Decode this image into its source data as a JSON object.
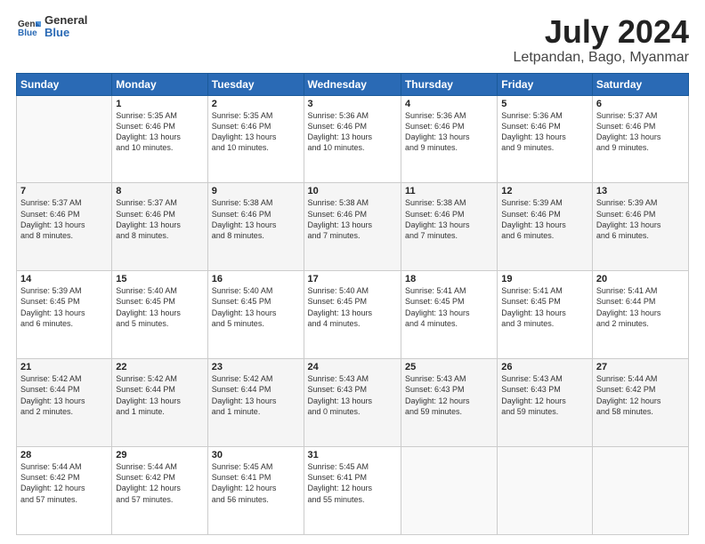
{
  "logo": {
    "line1": "General",
    "line2": "Blue"
  },
  "title": "July 2024",
  "subtitle": "Letpandan, Bago, Myanmar",
  "days_header": [
    "Sunday",
    "Monday",
    "Tuesday",
    "Wednesday",
    "Thursday",
    "Friday",
    "Saturday"
  ],
  "weeks": [
    [
      {
        "num": "",
        "info": ""
      },
      {
        "num": "1",
        "info": "Sunrise: 5:35 AM\nSunset: 6:46 PM\nDaylight: 13 hours\nand 10 minutes."
      },
      {
        "num": "2",
        "info": "Sunrise: 5:35 AM\nSunset: 6:46 PM\nDaylight: 13 hours\nand 10 minutes."
      },
      {
        "num": "3",
        "info": "Sunrise: 5:36 AM\nSunset: 6:46 PM\nDaylight: 13 hours\nand 10 minutes."
      },
      {
        "num": "4",
        "info": "Sunrise: 5:36 AM\nSunset: 6:46 PM\nDaylight: 13 hours\nand 9 minutes."
      },
      {
        "num": "5",
        "info": "Sunrise: 5:36 AM\nSunset: 6:46 PM\nDaylight: 13 hours\nand 9 minutes."
      },
      {
        "num": "6",
        "info": "Sunrise: 5:37 AM\nSunset: 6:46 PM\nDaylight: 13 hours\nand 9 minutes."
      }
    ],
    [
      {
        "num": "7",
        "info": "Sunrise: 5:37 AM\nSunset: 6:46 PM\nDaylight: 13 hours\nand 8 minutes."
      },
      {
        "num": "8",
        "info": "Sunrise: 5:37 AM\nSunset: 6:46 PM\nDaylight: 13 hours\nand 8 minutes."
      },
      {
        "num": "9",
        "info": "Sunrise: 5:38 AM\nSunset: 6:46 PM\nDaylight: 13 hours\nand 8 minutes."
      },
      {
        "num": "10",
        "info": "Sunrise: 5:38 AM\nSunset: 6:46 PM\nDaylight: 13 hours\nand 7 minutes."
      },
      {
        "num": "11",
        "info": "Sunrise: 5:38 AM\nSunset: 6:46 PM\nDaylight: 13 hours\nand 7 minutes."
      },
      {
        "num": "12",
        "info": "Sunrise: 5:39 AM\nSunset: 6:46 PM\nDaylight: 13 hours\nand 6 minutes."
      },
      {
        "num": "13",
        "info": "Sunrise: 5:39 AM\nSunset: 6:46 PM\nDaylight: 13 hours\nand 6 minutes."
      }
    ],
    [
      {
        "num": "14",
        "info": "Sunrise: 5:39 AM\nSunset: 6:45 PM\nDaylight: 13 hours\nand 6 minutes."
      },
      {
        "num": "15",
        "info": "Sunrise: 5:40 AM\nSunset: 6:45 PM\nDaylight: 13 hours\nand 5 minutes."
      },
      {
        "num": "16",
        "info": "Sunrise: 5:40 AM\nSunset: 6:45 PM\nDaylight: 13 hours\nand 5 minutes."
      },
      {
        "num": "17",
        "info": "Sunrise: 5:40 AM\nSunset: 6:45 PM\nDaylight: 13 hours\nand 4 minutes."
      },
      {
        "num": "18",
        "info": "Sunrise: 5:41 AM\nSunset: 6:45 PM\nDaylight: 13 hours\nand 4 minutes."
      },
      {
        "num": "19",
        "info": "Sunrise: 5:41 AM\nSunset: 6:45 PM\nDaylight: 13 hours\nand 3 minutes."
      },
      {
        "num": "20",
        "info": "Sunrise: 5:41 AM\nSunset: 6:44 PM\nDaylight: 13 hours\nand 2 minutes."
      }
    ],
    [
      {
        "num": "21",
        "info": "Sunrise: 5:42 AM\nSunset: 6:44 PM\nDaylight: 13 hours\nand 2 minutes."
      },
      {
        "num": "22",
        "info": "Sunrise: 5:42 AM\nSunset: 6:44 PM\nDaylight: 13 hours\nand 1 minute."
      },
      {
        "num": "23",
        "info": "Sunrise: 5:42 AM\nSunset: 6:44 PM\nDaylight: 13 hours\nand 1 minute."
      },
      {
        "num": "24",
        "info": "Sunrise: 5:43 AM\nSunset: 6:43 PM\nDaylight: 13 hours\nand 0 minutes."
      },
      {
        "num": "25",
        "info": "Sunrise: 5:43 AM\nSunset: 6:43 PM\nDaylight: 12 hours\nand 59 minutes."
      },
      {
        "num": "26",
        "info": "Sunrise: 5:43 AM\nSunset: 6:43 PM\nDaylight: 12 hours\nand 59 minutes."
      },
      {
        "num": "27",
        "info": "Sunrise: 5:44 AM\nSunset: 6:42 PM\nDaylight: 12 hours\nand 58 minutes."
      }
    ],
    [
      {
        "num": "28",
        "info": "Sunrise: 5:44 AM\nSunset: 6:42 PM\nDaylight: 12 hours\nand 57 minutes."
      },
      {
        "num": "29",
        "info": "Sunrise: 5:44 AM\nSunset: 6:42 PM\nDaylight: 12 hours\nand 57 minutes."
      },
      {
        "num": "30",
        "info": "Sunrise: 5:45 AM\nSunset: 6:41 PM\nDaylight: 12 hours\nand 56 minutes."
      },
      {
        "num": "31",
        "info": "Sunrise: 5:45 AM\nSunset: 6:41 PM\nDaylight: 12 hours\nand 55 minutes."
      },
      {
        "num": "",
        "info": ""
      },
      {
        "num": "",
        "info": ""
      },
      {
        "num": "",
        "info": ""
      }
    ]
  ]
}
